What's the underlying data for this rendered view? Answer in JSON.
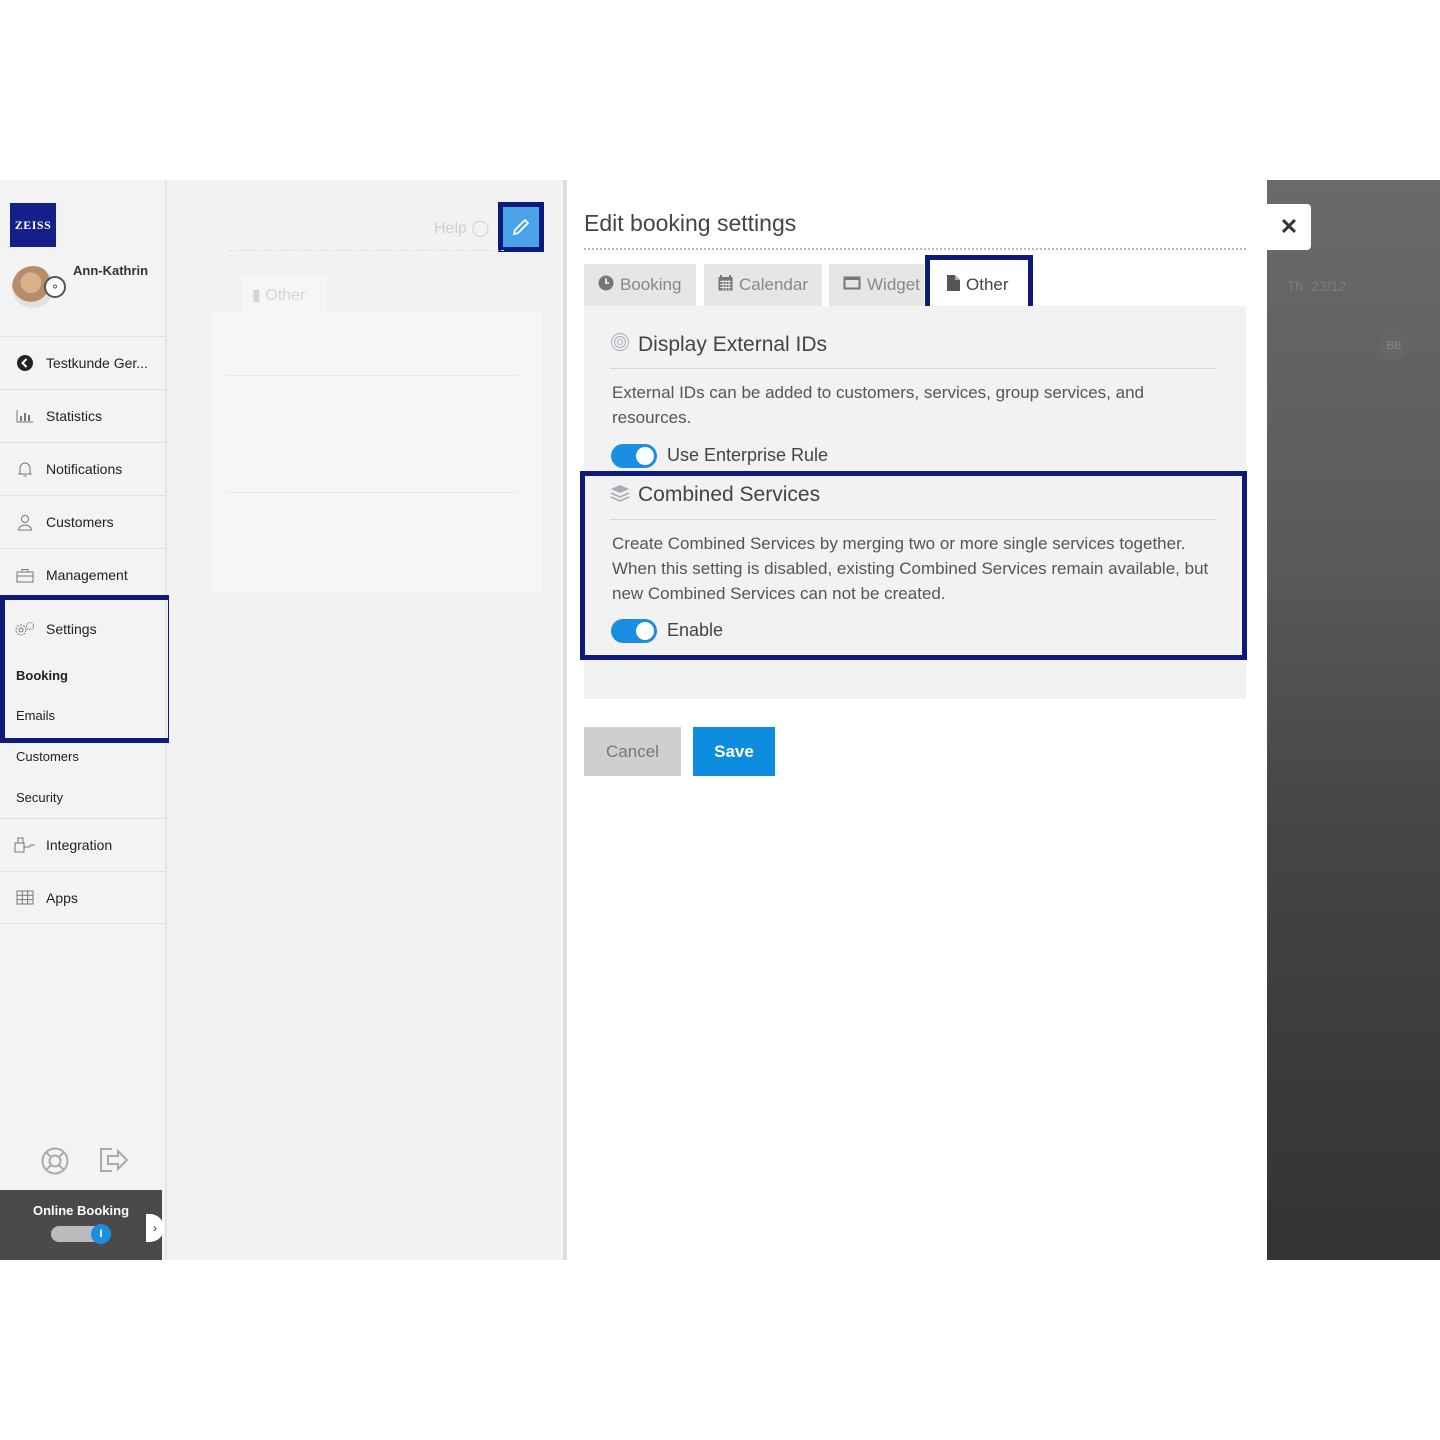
{
  "brand": {
    "logo_text": "ZEISS"
  },
  "user": {
    "name": "Ann-Kathrin"
  },
  "sidebar": {
    "items": [
      {
        "label": "Testkunde Ger...",
        "icon": "back-circle-icon"
      },
      {
        "label": "Statistics",
        "icon": "chart-icon"
      },
      {
        "label": "Notifications",
        "icon": "bell-icon"
      },
      {
        "label": "Customers",
        "icon": "person-icon"
      },
      {
        "label": "Management",
        "icon": "briefcase-icon"
      },
      {
        "label": "Settings",
        "icon": "gears-icon"
      }
    ],
    "settings_sub": [
      {
        "label": "Booking",
        "active": true
      },
      {
        "label": "Emails",
        "active": false
      },
      {
        "label": "Customers",
        "active": false
      },
      {
        "label": "Security",
        "active": false
      }
    ],
    "items_after": [
      {
        "label": "Integration",
        "icon": "integration-icon"
      },
      {
        "label": "Apps",
        "icon": "grid-icon"
      }
    ],
    "online_booking": {
      "label": "Online Booking",
      "enabled": true
    }
  },
  "middle": {
    "help_label": "Help",
    "tab_label": "Other"
  },
  "modal": {
    "title": "Edit booking settings",
    "tabs": [
      {
        "label": "Booking",
        "icon": "clock-icon"
      },
      {
        "label": "Calendar",
        "icon": "calendar-icon"
      },
      {
        "label": "Widget",
        "icon": "widget-icon"
      },
      {
        "label": "Other",
        "icon": "file-icon",
        "active": true
      }
    ],
    "sections": {
      "external_ids": {
        "title": "Display External IDs",
        "description": "External IDs can be added to customers, services, group services, and resources.",
        "toggle_label": "Use Enterprise Rule",
        "enabled": true
      },
      "combined_services": {
        "title": "Combined Services",
        "description": "Create Combined Services by merging two or more single services together. When this setting is disabled, existing Combined Services remain available, but new Combined Services can not be created.",
        "toggle_label": "Enable",
        "enabled": true
      }
    },
    "cancel_label": "Cancel",
    "save_label": "Save"
  },
  "overlay": {
    "date_label": "Th. 23/12",
    "badge_text": "BB"
  },
  "colors": {
    "accent": "#0c8de0",
    "highlight": "#0e1a7a"
  }
}
